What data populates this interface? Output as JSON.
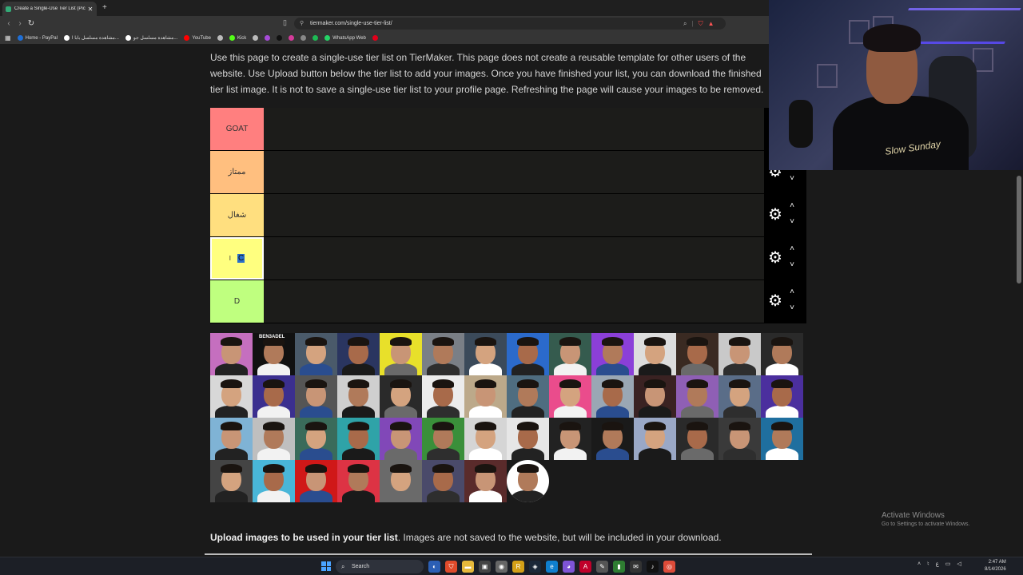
{
  "browser": {
    "tab_title": "Create a Single-Use Tier List (Pic",
    "tab_close": "✕",
    "new_tab": "+",
    "url": "tiermaker.com/single-use-tier-list/",
    "bookmarks": [
      {
        "label": "Home - PayPal",
        "color": "#1f6fd6"
      },
      {
        "label": "مشاهدة مسلسل بابا ا...",
        "color": "#ffffff"
      },
      {
        "label": "مشاهدة مسلسل جو...",
        "color": "#ffffff"
      },
      {
        "label": "YouTube",
        "color": "#ff0000"
      },
      {
        "label": "",
        "color": "#bbbbbb"
      },
      {
        "label": "Kick",
        "color": "#53fc18"
      },
      {
        "label": "",
        "color": "#bbbbbb"
      },
      {
        "label": "",
        "color": "#a64bd8"
      },
      {
        "label": "",
        "color": "#111111"
      },
      {
        "label": "",
        "color": "#d43b9a"
      },
      {
        "label": "",
        "color": "#888888"
      },
      {
        "label": "",
        "color": "#1db954"
      },
      {
        "label": "WhatsApp Web",
        "color": "#25d366"
      },
      {
        "label": "",
        "color": "#e2001a"
      }
    ]
  },
  "page": {
    "intro": "Use this page to create a single-use tier list on TierMaker. This page does not create a reusable template for other users of the website. Use Upload button below the tier list to add your images. Once you have finished your list, you can download the finished tier list image. It is not to save a single-use tier list to your profile page. Refreshing the page will cause your images to be removed.",
    "tiers": [
      {
        "label": "GOAT",
        "color": "#ff7f7f"
      },
      {
        "label": "ممتاز",
        "color": "#ffbf7f"
      },
      {
        "label": "شغال",
        "color": "#ffdf7f"
      },
      {
        "label": "C",
        "color": "#ffff7f",
        "editing": true
      },
      {
        "label": "D",
        "color": "#bfff7f"
      }
    ],
    "upload_bold": "Upload images to be used in your tier list",
    "upload_rest": ". Images are not saved to the website, but will be included in your download."
  },
  "pool_labels": {
    "ben3adel": "BEN3ADEL"
  },
  "cam": {
    "shirt_text": "Slow Sunday"
  },
  "windows": {
    "activate_title": "Activate Windows",
    "activate_sub": "Go to Settings to activate Windows.",
    "search_placeholder": "Search",
    "time": "2:47 AM",
    "date": "8/14/2026",
    "lang": "ع"
  },
  "icons": {
    "gear": "gear-icon",
    "chevron_up": "chevron-up-icon",
    "chevron_down": "chevron-down-icon"
  }
}
